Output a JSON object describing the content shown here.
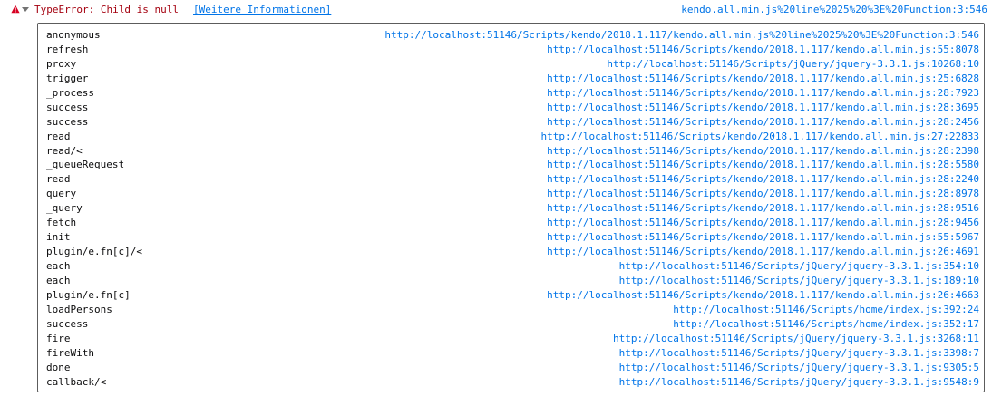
{
  "error": {
    "message": "TypeError: Child is null",
    "more_info": "[Weitere Informationen]",
    "source": "kendo.all.min.js%20line%2025%20%3E%20Function:3:546"
  },
  "colors": {
    "error_text": "#a4000f",
    "link": "#0074e8",
    "icon_warning": "#d70022"
  },
  "icons": {
    "warning": "warning-triangle-icon",
    "twisty": "chevron-down-icon"
  },
  "stack": [
    {
      "fn": "anonymous",
      "loc": "http://localhost:51146/Scripts/kendo/2018.1.117/kendo.all.min.js%20line%2025%20%3E%20Function:3:546"
    },
    {
      "fn": "refresh",
      "loc": "http://localhost:51146/Scripts/kendo/2018.1.117/kendo.all.min.js:55:8078"
    },
    {
      "fn": "proxy",
      "loc": "http://localhost:51146/Scripts/jQuery/jquery-3.3.1.js:10268:10"
    },
    {
      "fn": "trigger",
      "loc": "http://localhost:51146/Scripts/kendo/2018.1.117/kendo.all.min.js:25:6828"
    },
    {
      "fn": "_process",
      "loc": "http://localhost:51146/Scripts/kendo/2018.1.117/kendo.all.min.js:28:7923"
    },
    {
      "fn": "success",
      "loc": "http://localhost:51146/Scripts/kendo/2018.1.117/kendo.all.min.js:28:3695"
    },
    {
      "fn": "success",
      "loc": "http://localhost:51146/Scripts/kendo/2018.1.117/kendo.all.min.js:28:2456"
    },
    {
      "fn": "read",
      "loc": "http://localhost:51146/Scripts/kendo/2018.1.117/kendo.all.min.js:27:22833"
    },
    {
      "fn": "read/<",
      "loc": "http://localhost:51146/Scripts/kendo/2018.1.117/kendo.all.min.js:28:2398"
    },
    {
      "fn": "_queueRequest",
      "loc": "http://localhost:51146/Scripts/kendo/2018.1.117/kendo.all.min.js:28:5580"
    },
    {
      "fn": "read",
      "loc": "http://localhost:51146/Scripts/kendo/2018.1.117/kendo.all.min.js:28:2240"
    },
    {
      "fn": "query",
      "loc": "http://localhost:51146/Scripts/kendo/2018.1.117/kendo.all.min.js:28:8978"
    },
    {
      "fn": "_query",
      "loc": "http://localhost:51146/Scripts/kendo/2018.1.117/kendo.all.min.js:28:9516"
    },
    {
      "fn": "fetch",
      "loc": "http://localhost:51146/Scripts/kendo/2018.1.117/kendo.all.min.js:28:9456"
    },
    {
      "fn": "init",
      "loc": "http://localhost:51146/Scripts/kendo/2018.1.117/kendo.all.min.js:55:5967"
    },
    {
      "fn": "plugin/e.fn[c]/<",
      "loc": "http://localhost:51146/Scripts/kendo/2018.1.117/kendo.all.min.js:26:4691"
    },
    {
      "fn": "each",
      "loc": "http://localhost:51146/Scripts/jQuery/jquery-3.3.1.js:354:10"
    },
    {
      "fn": "each",
      "loc": "http://localhost:51146/Scripts/jQuery/jquery-3.3.1.js:189:10"
    },
    {
      "fn": "plugin/e.fn[c]",
      "loc": "http://localhost:51146/Scripts/kendo/2018.1.117/kendo.all.min.js:26:4663"
    },
    {
      "fn": "loadPersons",
      "loc": "http://localhost:51146/Scripts/home/index.js:392:24"
    },
    {
      "fn": "success",
      "loc": "http://localhost:51146/Scripts/home/index.js:352:17"
    },
    {
      "fn": "fire",
      "loc": "http://localhost:51146/Scripts/jQuery/jquery-3.3.1.js:3268:11"
    },
    {
      "fn": "fireWith",
      "loc": "http://localhost:51146/Scripts/jQuery/jquery-3.3.1.js:3398:7"
    },
    {
      "fn": "done",
      "loc": "http://localhost:51146/Scripts/jQuery/jquery-3.3.1.js:9305:5"
    },
    {
      "fn": "callback/<",
      "loc": "http://localhost:51146/Scripts/jQuery/jquery-3.3.1.js:9548:9"
    }
  ]
}
